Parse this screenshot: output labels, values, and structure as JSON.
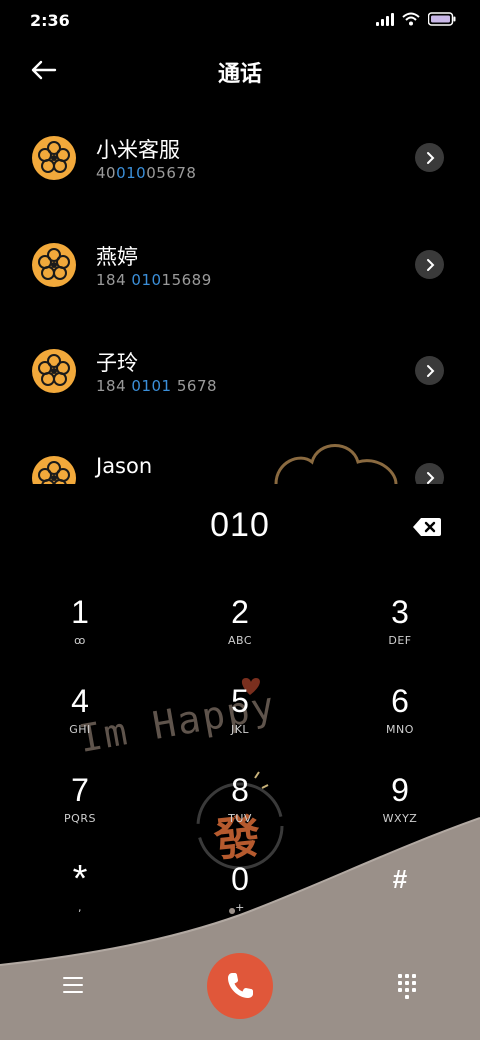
{
  "status": {
    "time": "2:36"
  },
  "header": {
    "title": "通话"
  },
  "contacts": [
    {
      "name": "小米客服",
      "number_parts": [
        "40",
        "010",
        "05678"
      ]
    },
    {
      "name": "燕婷",
      "number_parts": [
        "184 ",
        "010",
        "15689"
      ]
    },
    {
      "name": "子玲",
      "number_parts": [
        "184 ",
        "0101",
        " 5678"
      ]
    },
    {
      "name": "Jason",
      "number_parts": [
        "",
        "",
        ""
      ]
    }
  ],
  "dial": {
    "number": "010"
  },
  "keypad": [
    {
      "digit": "1",
      "letters": "ꝏ"
    },
    {
      "digit": "2",
      "letters": "ABC"
    },
    {
      "digit": "3",
      "letters": "DEF"
    },
    {
      "digit": "4",
      "letters": "GHI"
    },
    {
      "digit": "5",
      "letters": "JKL"
    },
    {
      "digit": "6",
      "letters": "MNO"
    },
    {
      "digit": "7",
      "letters": "PQRS"
    },
    {
      "digit": "8",
      "letters": "TUV"
    },
    {
      "digit": "9",
      "letters": "WXYZ"
    },
    {
      "digit": "*",
      "letters": ","
    },
    {
      "digit": "0",
      "letters": "+"
    },
    {
      "digit": "#",
      "letters": ""
    }
  ],
  "wallpaper": {
    "text": "Im Happy",
    "seal": "發"
  },
  "colors": {
    "accent_blue": "#3b8fd9",
    "call_red": "#e0573a",
    "avatar_orange": "#f2a93b",
    "wave_taupe": "#9a9089"
  }
}
